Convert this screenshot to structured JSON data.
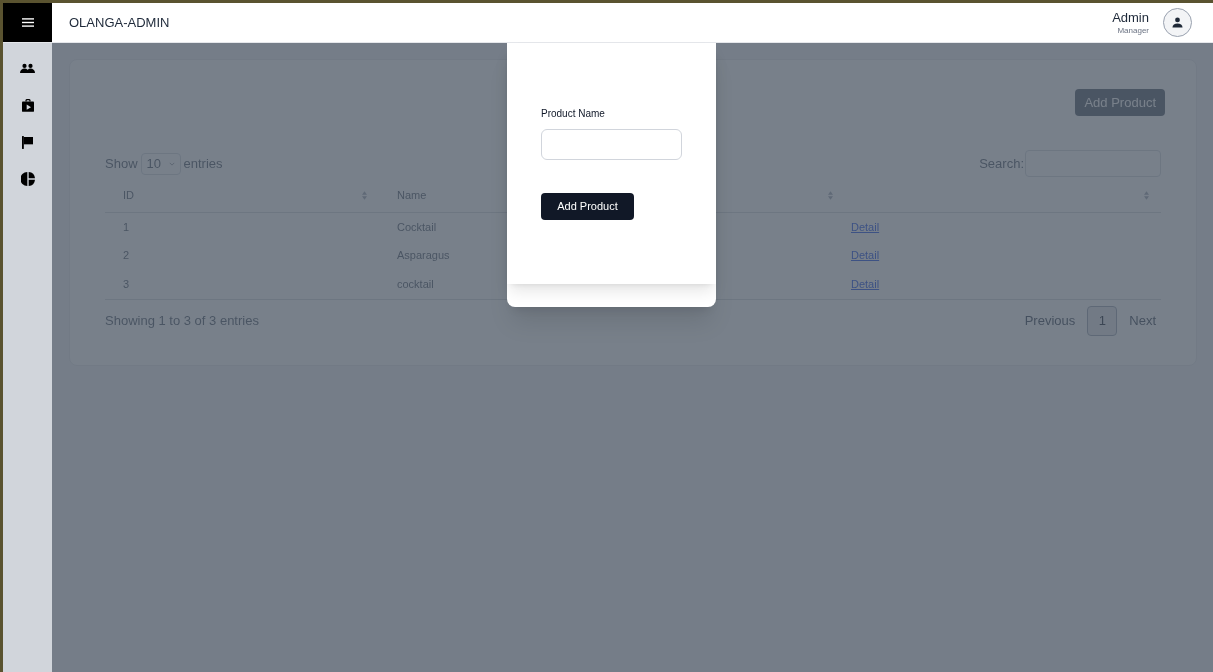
{
  "header": {
    "title": "OLANGA-ADMIN",
    "user_name": "Admin",
    "user_role": "Manager"
  },
  "sidebar": {
    "items": [
      {
        "kind": "people"
      },
      {
        "kind": "bag"
      },
      {
        "kind": "flag"
      },
      {
        "kind": "chart"
      }
    ]
  },
  "page": {
    "add_button": "Add Product",
    "show_label": "Show",
    "page_size": "10",
    "entries_label": "entries",
    "search_label": "Search:",
    "table": {
      "columns": [
        {
          "label": "ID"
        },
        {
          "label": "Name"
        }
      ],
      "rows": [
        {
          "id": "1",
          "name": "Cocktail",
          "link": "Detail"
        },
        {
          "id": "2",
          "name": "Asparagus",
          "link": "Detail"
        },
        {
          "id": "3",
          "name": "cocktail",
          "link": "Detail"
        }
      ]
    },
    "info": "Showing 1 to 3 of 3 entries",
    "pagination": {
      "previous": "Previous",
      "pages": [
        {
          "label": "1",
          "selected": true
        }
      ],
      "next": "Next"
    }
  },
  "modal": {
    "field_label": "Product Name",
    "submit": "Add Product"
  }
}
